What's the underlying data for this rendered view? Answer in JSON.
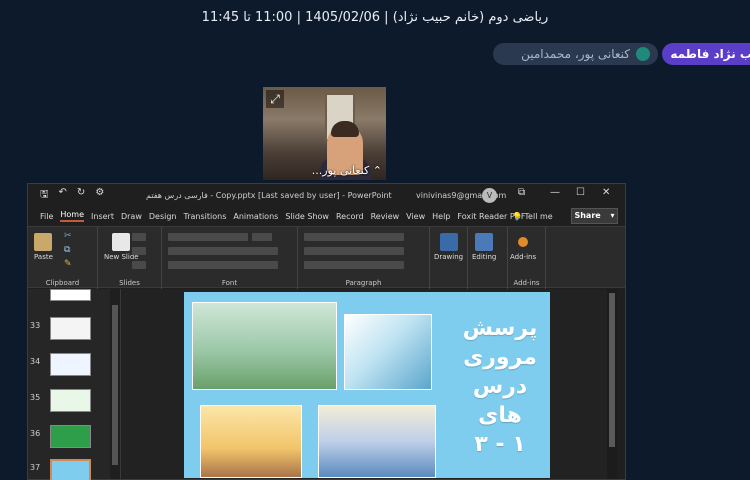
{
  "meeting": {
    "title": "ریاضی دوم (خانم حبیب نژاد) | 1405/02/06 | 11:00 تا 11:45",
    "host_chip": "ب نژاد فاطمه",
    "student_chip": "کنعانی پور، محمدامین"
  },
  "video": {
    "name": "کنعانی پور...",
    "expand_icon": "expand-icon"
  },
  "powerpoint": {
    "file_title": "فارسی درس هفتم - Copy.pptx  [Last saved by user]  -  PowerPoint",
    "account_email": "vinivinas9@gmail.com",
    "avatar_letter": "V",
    "menu": [
      "File",
      "Home",
      "Insert",
      "Draw",
      "Design",
      "Transitions",
      "Animations",
      "Slide Show",
      "Record",
      "Review",
      "View",
      "Help",
      "Foxit Reader PDF"
    ],
    "active_tab": "Home",
    "tell_me": "Tell me",
    "share_label": "Share",
    "ribbon": {
      "paste": "Paste",
      "new_slide": "New Slide",
      "drawing": "Drawing",
      "editing": "Editing",
      "addins": "Add-ins",
      "groups": {
        "clipboard": "Clipboard",
        "slides": "Slides",
        "font": "Font",
        "paragraph": "Paragraph",
        "addins": "Add-ins"
      }
    },
    "thumbnails": [
      {
        "num": "",
        "color": "#ffffff"
      },
      {
        "num": "33",
        "color": "#f4f4f4"
      },
      {
        "num": "34",
        "color": "#eef5ff"
      },
      {
        "num": "35",
        "color": "#e8f7e8"
      },
      {
        "num": "36",
        "color": "#2f9e4a"
      },
      {
        "num": "37",
        "color": "#7fcdee"
      }
    ],
    "selected_thumbnail": "37",
    "slide": {
      "lines": [
        "پرسش",
        "مروری",
        "درس های",
        "۱ - ۳"
      ]
    }
  },
  "colors": {
    "background": "#0d1a2b",
    "host_chip": "#5a3ec8",
    "slide_bg": "#7fcdee",
    "accent": "#c55a3a"
  }
}
